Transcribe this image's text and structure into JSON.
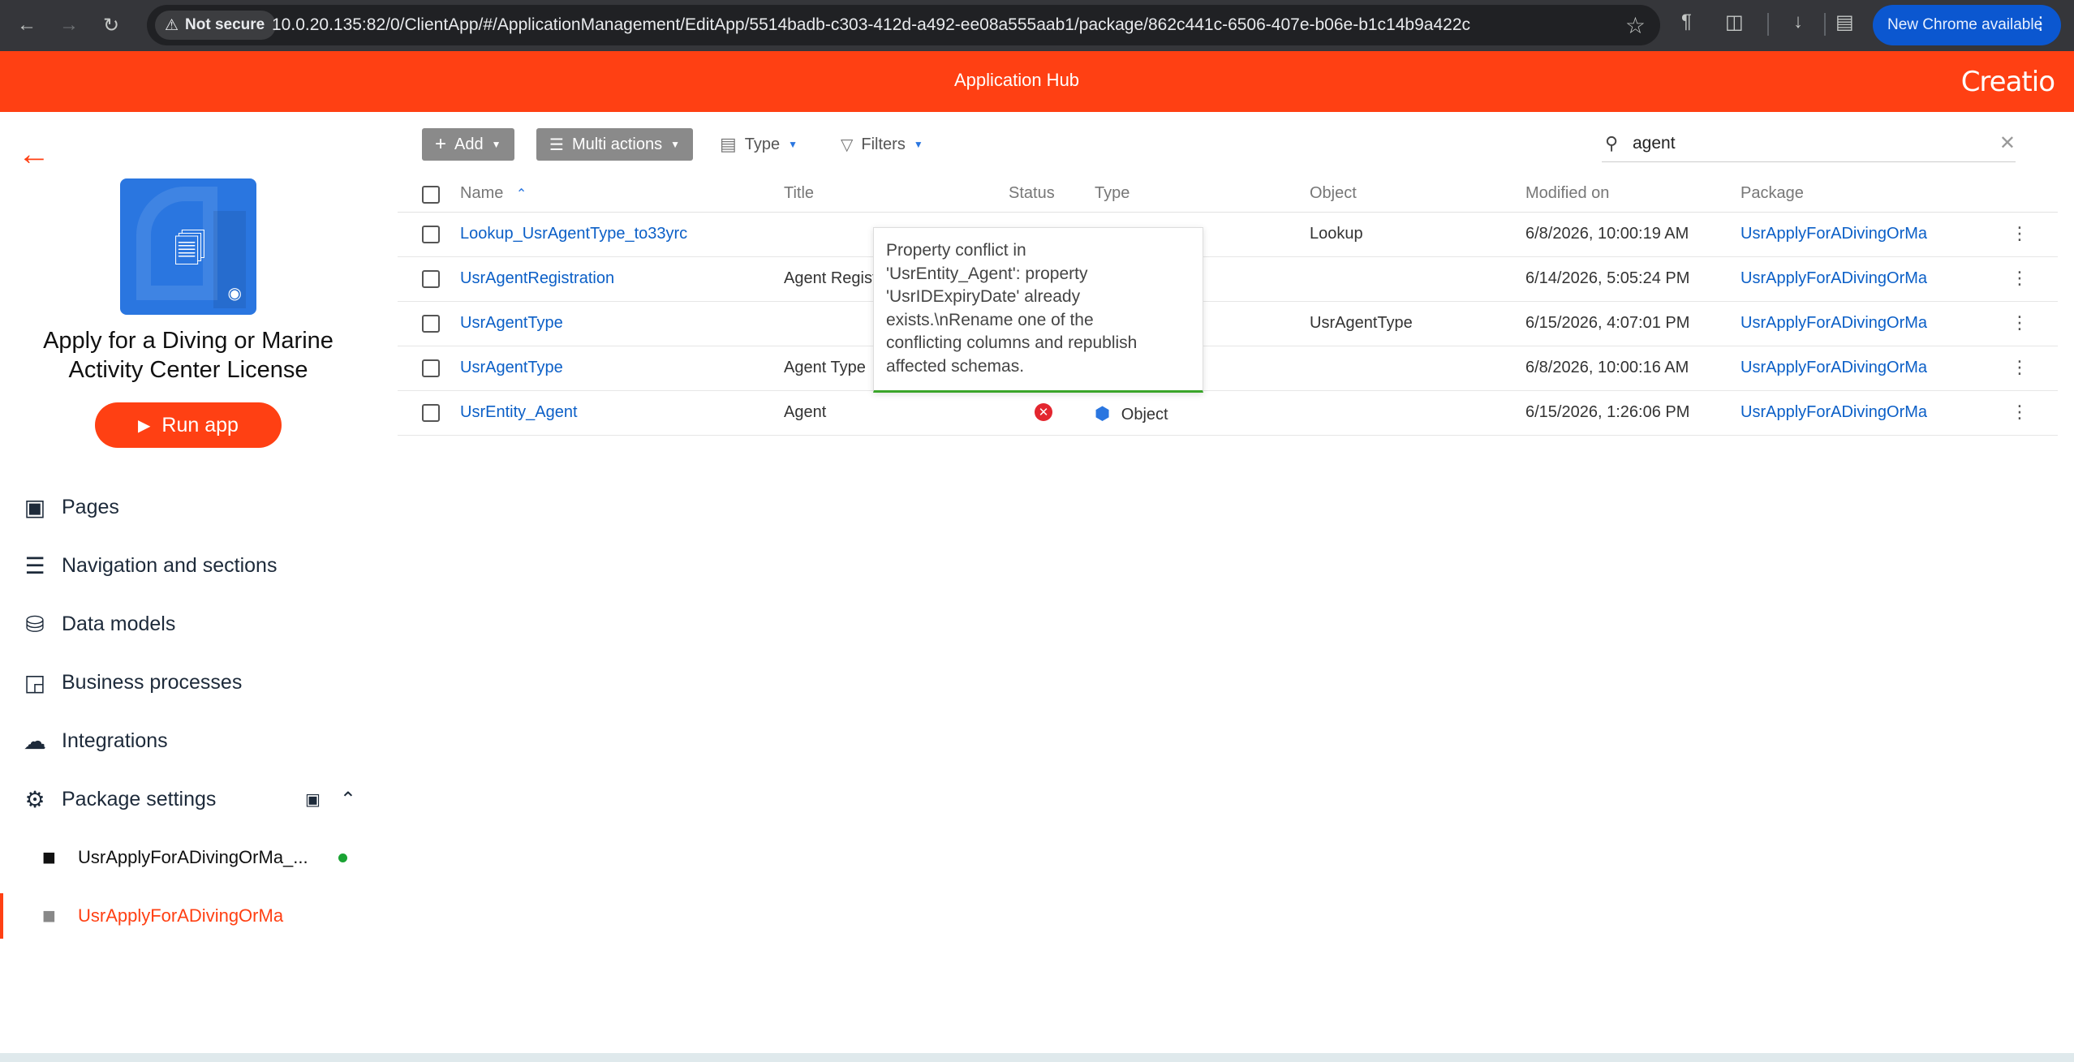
{
  "browser": {
    "security_label": "Not secure",
    "url": "10.0.20.135:82/0/ClientApp/#/ApplicationManagement/EditApp/5514badb-c303-412d-a492-ee08a555aab1/package/862c441c-6506-407e-b06e-b1c14b9a422c",
    "update_label": "New Chrome available"
  },
  "header": {
    "title": "Application Hub",
    "logo": "Creatio",
    "accent_color": "#ff4013"
  },
  "sidebar": {
    "app_name": "Apply for a Diving or Marine Activity Center License",
    "run_label": "Run app",
    "menu": [
      {
        "label": "Pages",
        "icon": "window-icon"
      },
      {
        "label": "Navigation and sections",
        "icon": "list-icon"
      },
      {
        "label": "Data models",
        "icon": "database-icon"
      },
      {
        "label": "Business processes",
        "icon": "process-icon"
      },
      {
        "label": "Integrations",
        "icon": "cloud-upload-icon"
      },
      {
        "label": "Package settings",
        "icon": "gear-icon"
      }
    ],
    "packages": [
      {
        "label": "UsrApplyForADivingOrMa_...",
        "active": false
      },
      {
        "label": "UsrApplyForADivingOrMa",
        "active": true
      }
    ]
  },
  "toolbar": {
    "add_label": "Add",
    "multi_label": "Multi actions",
    "type_label": "Type",
    "filters_label": "Filters",
    "search_value": "agent"
  },
  "table": {
    "columns": [
      "Name",
      "Title",
      "Status",
      "Type",
      "Object",
      "Modified on",
      "Package"
    ],
    "rows": [
      {
        "name": "Lookup_UsrAgentType_to33yrc",
        "title": "",
        "status": "",
        "type": "",
        "object": "Lookup",
        "modified": "6/8/2026, 10:00:19 AM",
        "package": "UsrApplyForADivingOrMa"
      },
      {
        "name": "UsrAgentRegistration",
        "title": "Agent Regist",
        "status": "",
        "type": "",
        "object": "",
        "modified": "6/14/2026, 5:05:24 PM",
        "package": "UsrApplyForADivingOrMa"
      },
      {
        "name": "UsrAgentType",
        "title": "",
        "status": "",
        "type": "",
        "object": "UsrAgentType",
        "modified": "6/15/2026, 4:07:01 PM",
        "package": "UsrApplyForADivingOrMa"
      },
      {
        "name": "UsrAgentType",
        "title": "Agent Type",
        "status": "",
        "type": "",
        "object": "",
        "modified": "6/8/2026, 10:00:16 AM",
        "package": "UsrApplyForADivingOrMa"
      },
      {
        "name": "UsrEntity_Agent",
        "title": "Agent",
        "status": "error",
        "type": "Object",
        "object": "",
        "modified": "6/15/2026, 1:26:06 PM",
        "package": "UsrApplyForADivingOrMa"
      }
    ]
  },
  "tooltip": {
    "lines": [
      "Property conflict in",
      "'UsrEntity_Agent': property",
      "'UsrIDExpiryDate' already",
      "exists.\\nRename one of the",
      "conflicting columns and republish",
      "affected schemas."
    ]
  }
}
